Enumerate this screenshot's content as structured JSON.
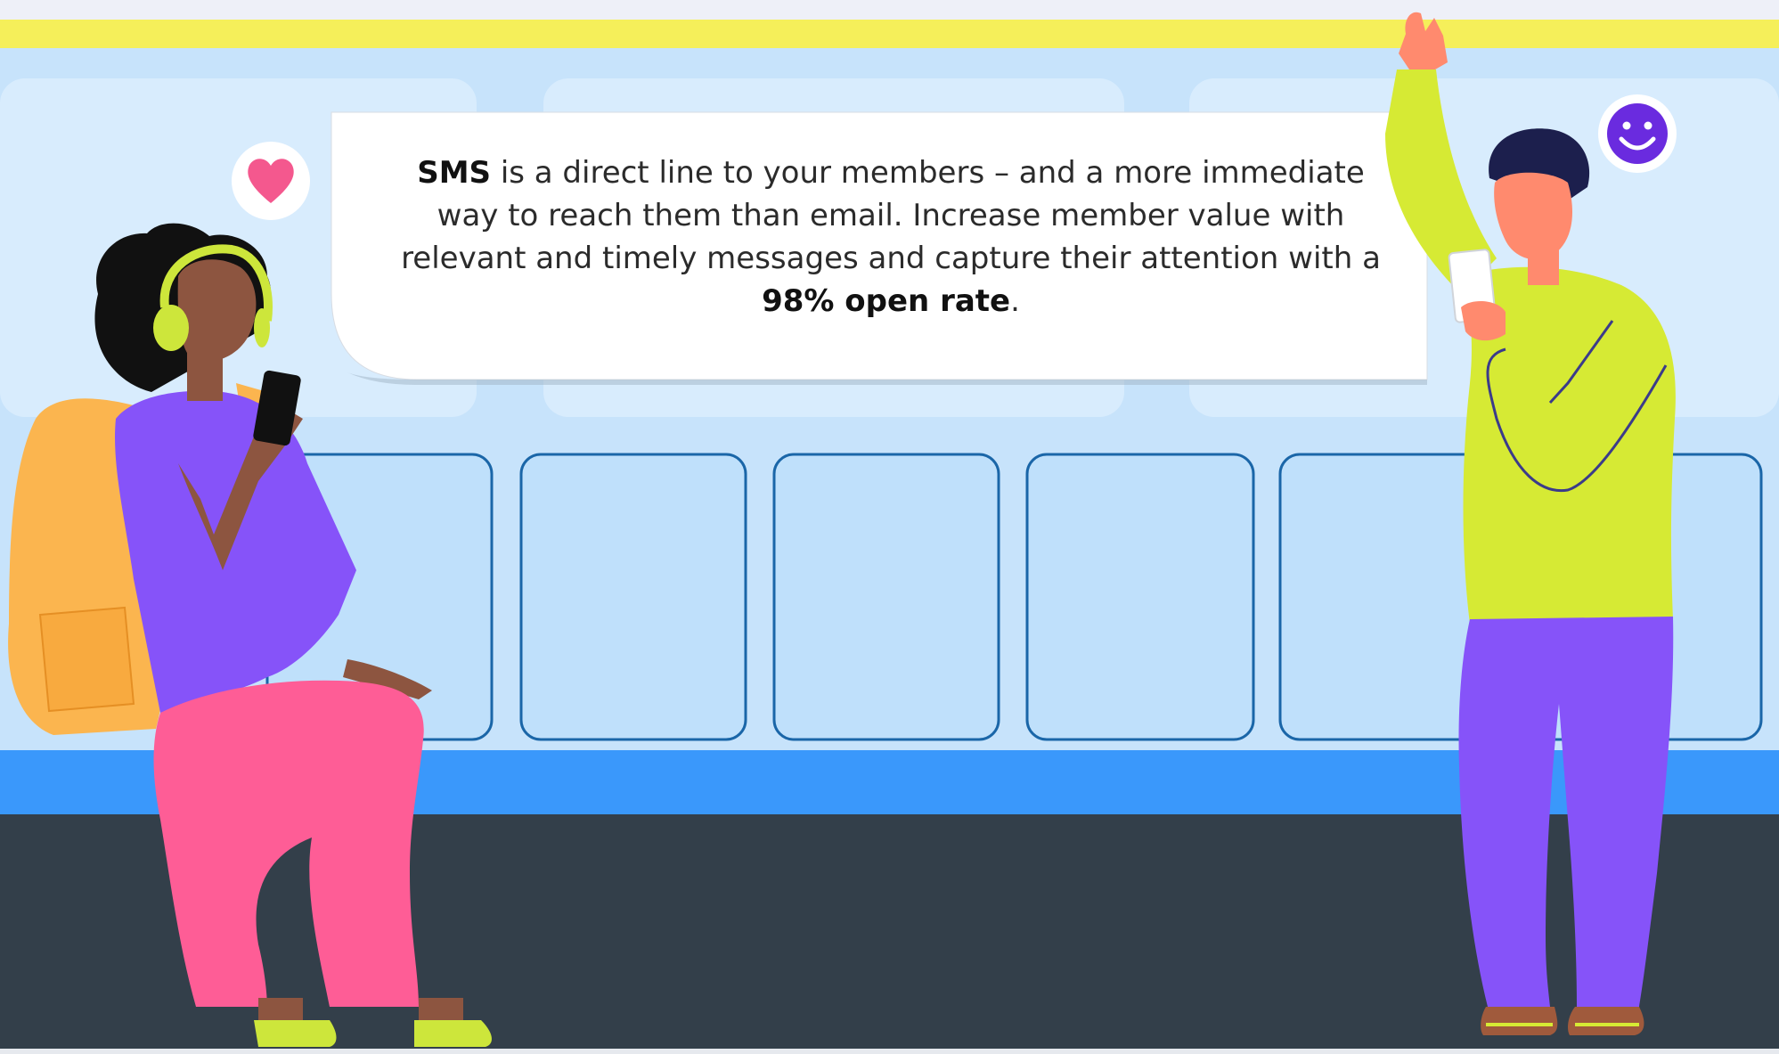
{
  "message": {
    "part1_bold": "SMS",
    "part2": " is a direct line to your members – and a more immediate way to reach them than email. Increase member value with relevant and timely messages and capture their attention with a ",
    "part3_bold": "98% open rate",
    "part4": "."
  },
  "colors": {
    "sky": "#c8e3fb",
    "wall": "#bfe0fb",
    "stripe_yellow": "#f5ef5a",
    "stripe_blue": "#3a98fb",
    "floor": "#333f4a",
    "window_outline": "#1a66a8",
    "heart": "#f4588e",
    "smiley": "#6a2bdf",
    "purple_top": "#8653f9",
    "pink_pants": "#fe5d96",
    "backpack": "#fbb54f",
    "lime": "#d6ea34",
    "skin_dark": "#8d5540",
    "skin_light": "#ff8a6e"
  },
  "icons": [
    "heart-icon",
    "smiley-icon"
  ]
}
